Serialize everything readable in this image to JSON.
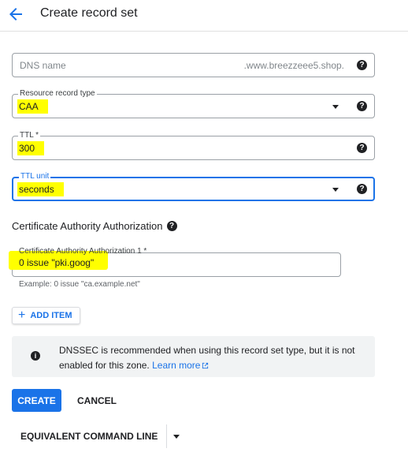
{
  "header": {
    "title": "Create record set"
  },
  "dns_name": {
    "placeholder": "DNS name",
    "suffix": ".www.breezzeee5.shop."
  },
  "record_type": {
    "label": "Resource record type",
    "value": "CAA"
  },
  "ttl": {
    "label": "TTL *",
    "value": "300"
  },
  "ttl_unit": {
    "label": "TTL unit",
    "value": "seconds"
  },
  "caa_section": {
    "title": "Certificate Authority Authorization",
    "field_label": "Certificate Authority Authorization 1 *",
    "field_value": "0 issue \"pki.goog\"",
    "example": "Example: 0 issue \"ca.example.net\""
  },
  "add_item": {
    "label": "ADD ITEM"
  },
  "info": {
    "text": "DNSSEC is recommended when using this record set type, but it is not enabled for this zone.",
    "link": "Learn more"
  },
  "actions": {
    "create": "CREATE",
    "cancel": "CANCEL",
    "command_line": "EQUIVALENT COMMAND LINE"
  },
  "colors": {
    "accent": "#1a73e8",
    "highlight": "#ffff00"
  },
  "icons": {
    "back": "arrow-left",
    "help": "question-circle",
    "info": "info-circle",
    "external": "external-link"
  }
}
